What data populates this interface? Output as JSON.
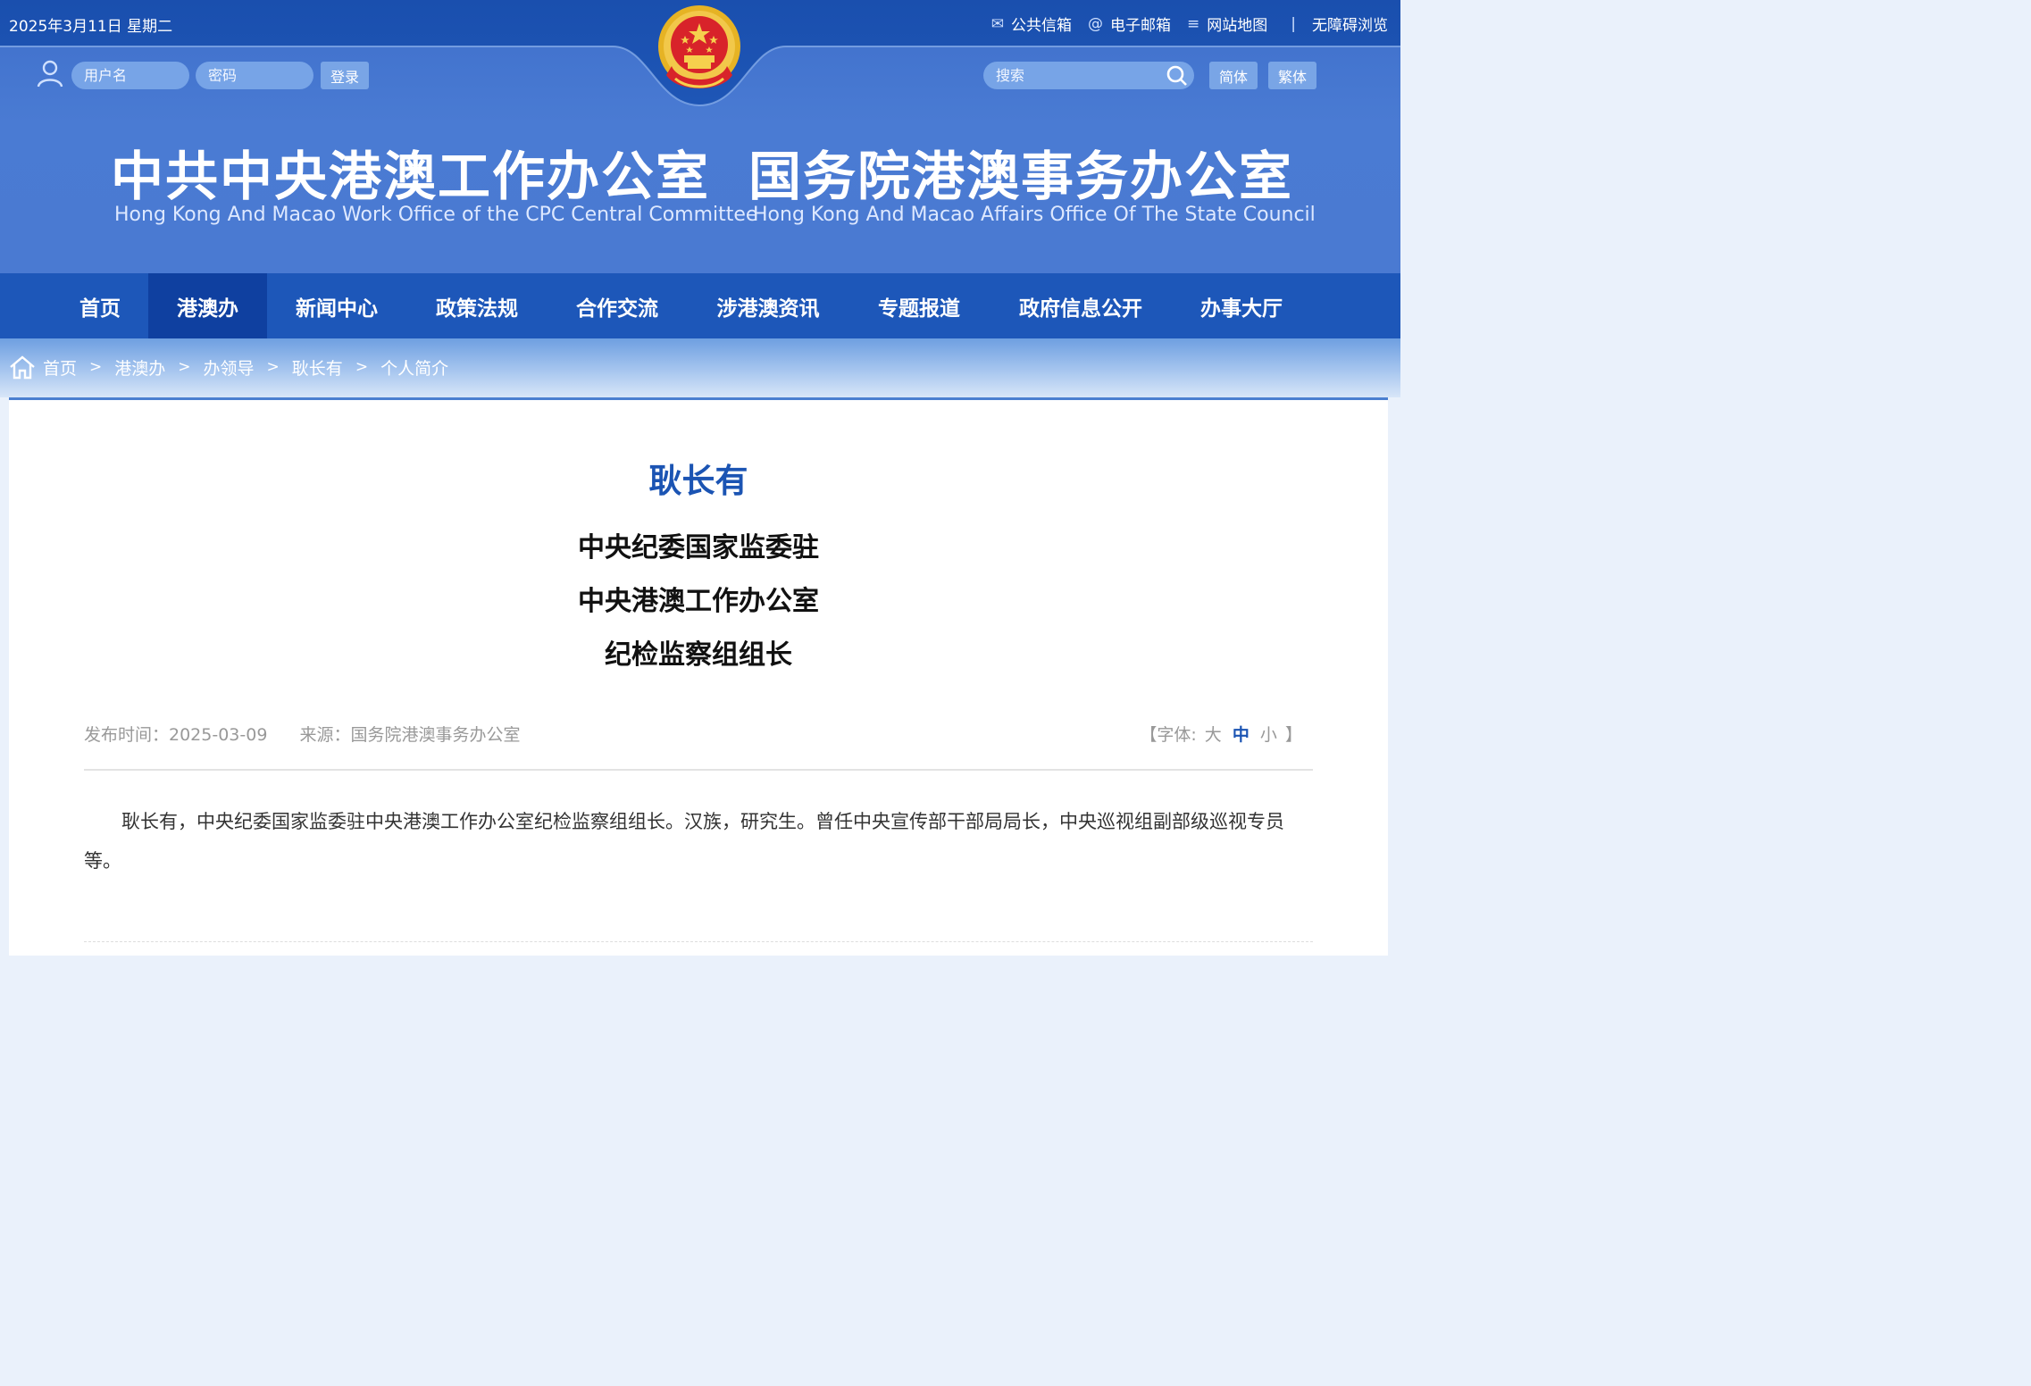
{
  "topbar": {
    "date": "2025年3月11日 星期二",
    "links": [
      {
        "icon": "envelope-icon",
        "glyph": "✉",
        "label": "公共信箱"
      },
      {
        "icon": "at-icon",
        "glyph": "@",
        "label": "电子邮箱"
      },
      {
        "icon": "menu-icon",
        "glyph": "≡",
        "label": "网站地图"
      }
    ],
    "separator": "|",
    "accessibility": "无障碍浏览"
  },
  "login": {
    "username_placeholder": "用户名",
    "password_placeholder": "密码",
    "login_label": "登录"
  },
  "search": {
    "placeholder": "搜索",
    "simplified_label": "简体",
    "traditional_label": "繁体"
  },
  "titles": {
    "left_cn": "中共中央港澳工作办公室",
    "left_en": "Hong Kong And Macao Work Office of the CPC Central Committee",
    "right_cn": "国务院港澳事务办公室",
    "right_en": "Hong Kong And Macao Affairs Office Of The State Council"
  },
  "nav": {
    "items": [
      {
        "label": "首页"
      },
      {
        "label": "港澳办"
      },
      {
        "label": "新闻中心"
      },
      {
        "label": "政策法规"
      },
      {
        "label": "合作交流"
      },
      {
        "label": "涉港澳资讯"
      },
      {
        "label": "专题报道"
      },
      {
        "label": "政府信息公开"
      },
      {
        "label": "办事大厅"
      }
    ],
    "active": "港澳办"
  },
  "breadcrumb": {
    "items": [
      "首页",
      "港澳办",
      "办领导",
      "耿长有",
      "个人简介"
    ],
    "separator": ">"
  },
  "article": {
    "name": "耿长有",
    "title_lines": [
      "中央纪委国家监委驻",
      "中央港澳工作办公室",
      "纪检监察组组长"
    ],
    "publish_time": "发布时间：2025-03-09",
    "source": "来源：国务院港澳事务办公室",
    "fontsize_prefix": "【字体: ",
    "fontsize_large": "大",
    "fontsize_medium": "中",
    "fontsize_small": "小",
    "fontsize_suffix": "】",
    "bio": "耿长有，中央纪委国家监委驻中央港澳工作办公室纪检监察组组长。汉族，研究生。曾任中央宣传部干部局局长，中央巡视组副部级巡视专员等。"
  },
  "colors": {
    "header_blue": "#4a7bd3",
    "nav_blue": "#1d57b9",
    "nav_active": "#0f40a0",
    "name_blue": "#1b54b3"
  }
}
